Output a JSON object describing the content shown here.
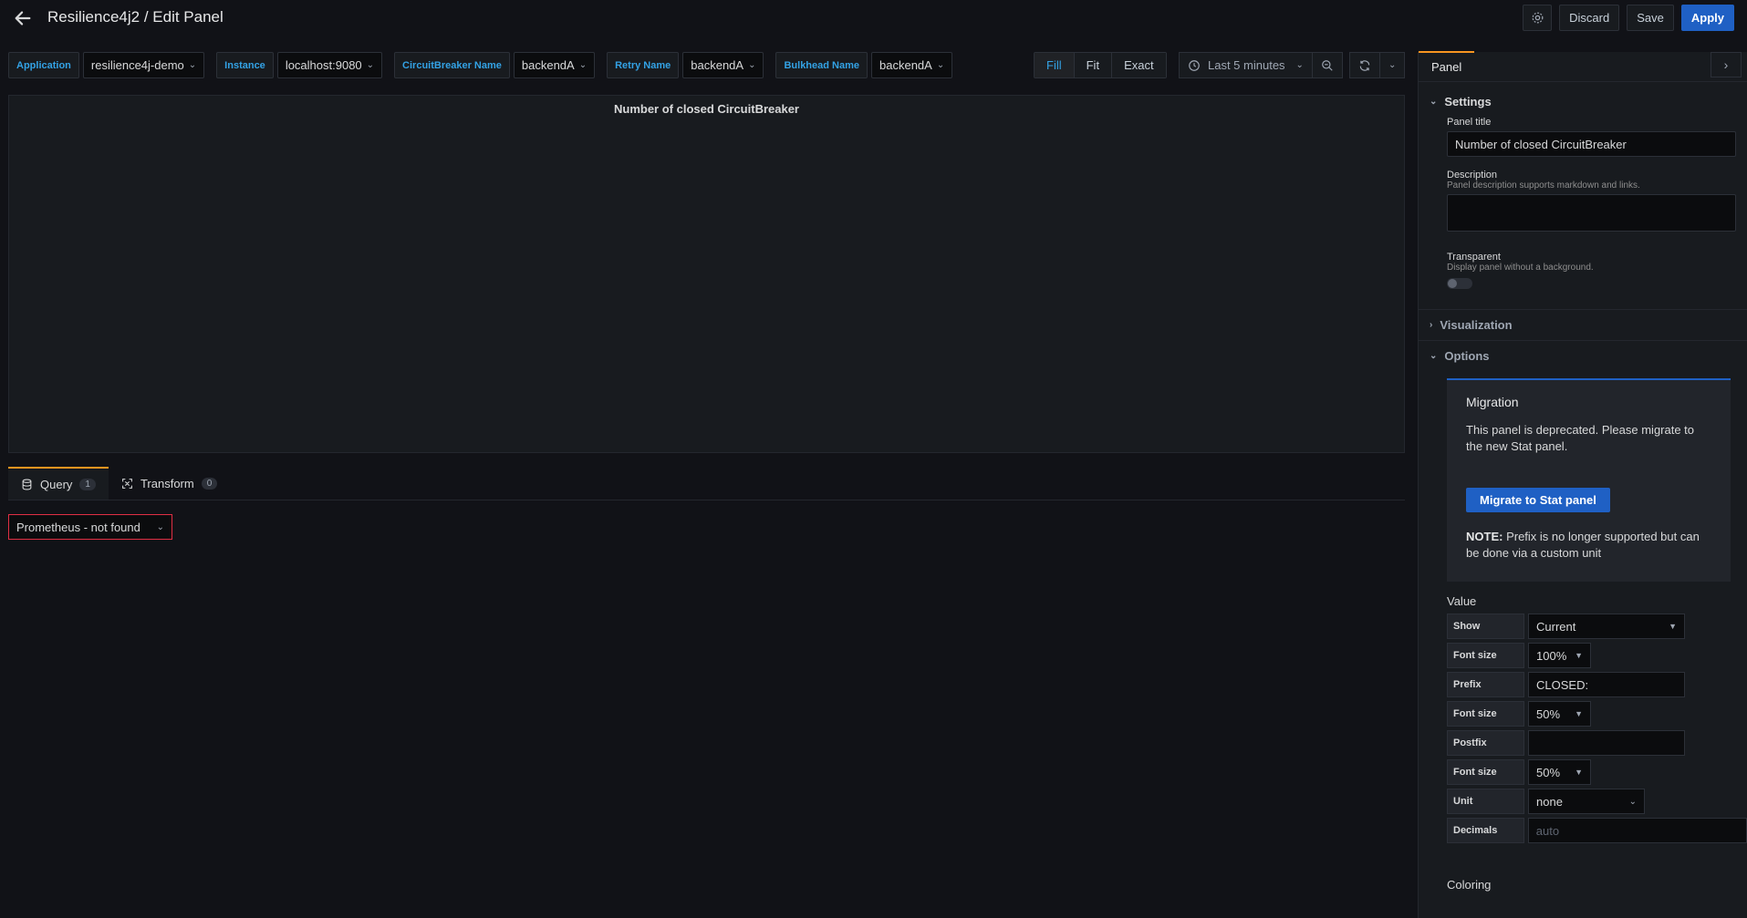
{
  "header": {
    "title": "Resilience4j2 / Edit Panel",
    "discard_label": "Discard",
    "save_label": "Save",
    "apply_label": "Apply"
  },
  "variables": [
    {
      "label": "Application",
      "value": "resilience4j-demo"
    },
    {
      "label": "Instance",
      "value": "localhost:9080"
    },
    {
      "label": "CircuitBreaker Name",
      "value": "backendA"
    },
    {
      "label": "Retry Name",
      "value": "backendA"
    },
    {
      "label": "Bulkhead Name",
      "value": "backendA"
    }
  ],
  "view_modes": {
    "fill": "Fill",
    "fit": "Fit",
    "exact": "Exact",
    "active": "Fill"
  },
  "time_range": "Last 5 minutes",
  "panel": {
    "title": "Number of closed CircuitBreaker"
  },
  "query_tabs": {
    "query": {
      "label": "Query",
      "count": "1"
    },
    "transform": {
      "label": "Transform",
      "count": "0"
    }
  },
  "datasource": "Prometheus - not found",
  "options": {
    "tab": "Panel",
    "settings": {
      "heading": "Settings",
      "panel_title_label": "Panel title",
      "panel_title_value": "Number of closed CircuitBreaker",
      "description_label": "Description",
      "description_help": "Panel description supports markdown and links.",
      "transparent_label": "Transparent",
      "transparent_help": "Display panel without a background."
    },
    "visualization_heading": "Visualization",
    "options_heading": "Options",
    "migration": {
      "title": "Migration",
      "text": "This panel is deprecated. Please migrate to the new Stat panel.",
      "button": "Migrate to Stat panel",
      "note_bold": "NOTE:",
      "note_text": " Prefix is no longer supported but can be done via a custom unit"
    },
    "value": {
      "heading": "Value",
      "rows": [
        {
          "label": "Show",
          "value": "Current"
        },
        {
          "label": "Font size",
          "value": "100%"
        },
        {
          "label": "Prefix",
          "value": "CLOSED:"
        },
        {
          "label": "Font size",
          "value": "50%"
        },
        {
          "label": "Postfix",
          "value": ""
        },
        {
          "label": "Font size",
          "value": "50%"
        },
        {
          "label": "Unit",
          "value": "none"
        },
        {
          "label": "Decimals",
          "placeholder": "auto"
        }
      ]
    },
    "coloring_heading": "Coloring"
  }
}
